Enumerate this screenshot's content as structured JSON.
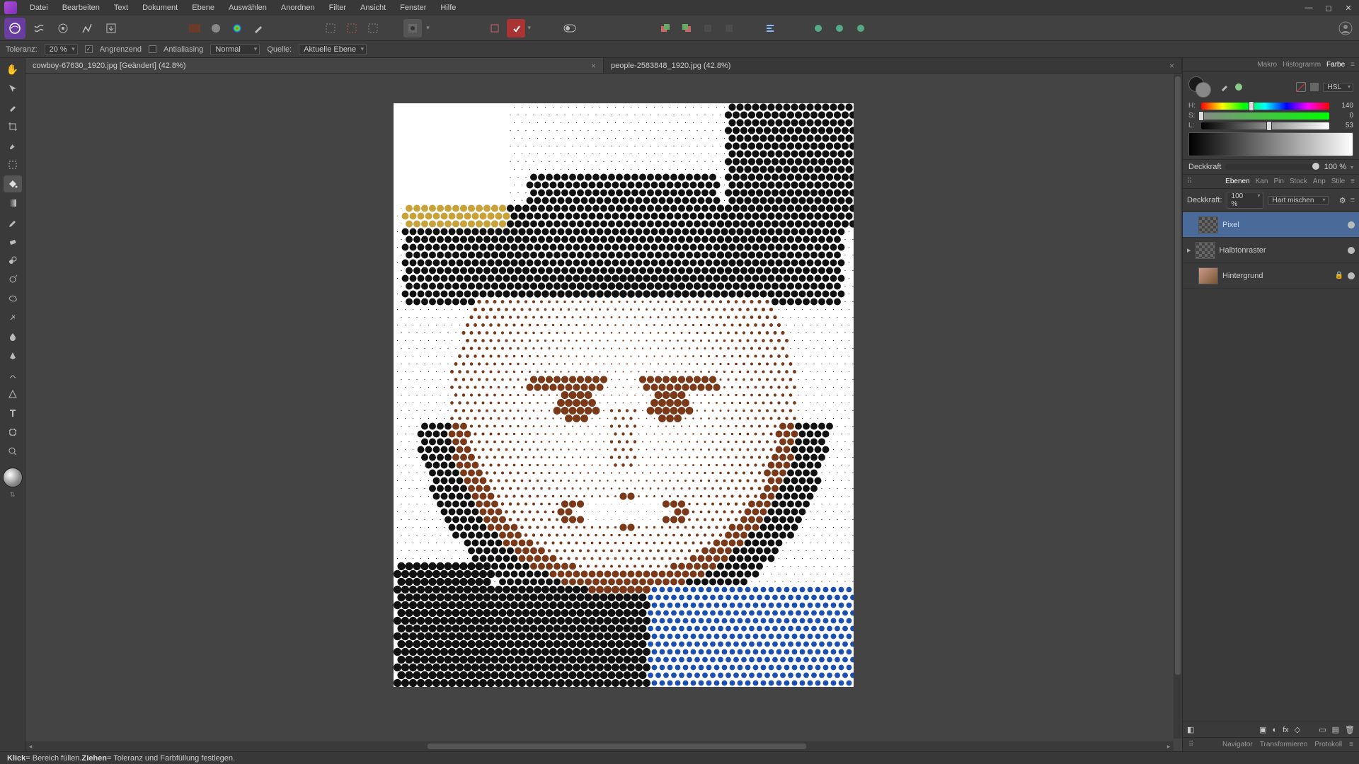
{
  "menus": [
    "Datei",
    "Bearbeiten",
    "Text",
    "Dokument",
    "Ebene",
    "Auswählen",
    "Anordnen",
    "Filter",
    "Ansicht",
    "Fenster",
    "Hilfe"
  ],
  "context": {
    "tolerance_label": "Toleranz:",
    "tolerance_value": "20 %",
    "contiguous": "Angrenzend",
    "antialias": "Antialiasing",
    "blend": "Normal",
    "source_label": "Quelle:",
    "source_value": "Aktuelle Ebene"
  },
  "tabs": [
    {
      "title": "cowboy-67630_1920.jpg [Geändert] (42.8%)",
      "active": true
    },
    {
      "title": "people-2583848_1920.jpg (42.8%)",
      "active": false
    }
  ],
  "colorpanel": {
    "tabs": [
      "Makro",
      "Histogramm",
      "Farbe"
    ],
    "active": "Farbe",
    "mode": "HSL",
    "h": {
      "label": "H:",
      "value": "140"
    },
    "s": {
      "label": "S:",
      "value": "0"
    },
    "l": {
      "label": "L:",
      "value": "53"
    },
    "opacity_label": "Deckkraft",
    "opacity_value": "100 %"
  },
  "layerspanel": {
    "tabs": [
      "Ebenen",
      "Kan",
      "Pin",
      "Stock",
      "Anp",
      "Stile"
    ],
    "active": "Ebenen",
    "opacity_label": "Deckkraft:",
    "opacity_value": "100 %",
    "blend": "Hart mischen",
    "layers": [
      {
        "name": "Pixel",
        "selected": true,
        "visible": true
      },
      {
        "name": "Halbtonraster",
        "selected": false,
        "visible": true,
        "indent": true
      },
      {
        "name": "Hintergrund",
        "selected": false,
        "visible": true,
        "locked": true,
        "img": true
      }
    ]
  },
  "bottomtabs": [
    "Navigator",
    "Transformieren",
    "Protokoll"
  ],
  "status": {
    "klick": "Klick",
    "klick_txt": " = Bereich füllen. ",
    "ziehen": "Ziehen",
    "ziehen_txt": " = Toleranz und Farbfüllung festlegen."
  }
}
